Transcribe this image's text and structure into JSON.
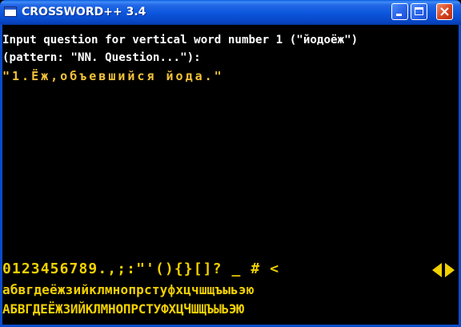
{
  "window": {
    "title": "CROSSWORD++ 3.4"
  },
  "console": {
    "prompt_line_1": "Input question for vertical word number 1 (\"йодоёж\")",
    "prompt_line_2": "(pattern: \"NN. Question...\"):",
    "question_value": "\"1.Ёж,объевшийся йода.\""
  },
  "keyboard": {
    "symbol_row": "0123456789.,;:\"'(){}[]? _ # <",
    "lower_row": "абвгдеёжзийклмнопрстуфхцчшщъыьэю",
    "upper_row": "АБВГДЕЁЖЗИЙКЛМНОПРСТУФХЦЧШЩЪЫЬЭЮ",
    "scroll_left_icon": "arrow-left-icon",
    "scroll_right_icon": "arrow-right-icon",
    "accent_color": "#f2d100"
  }
}
